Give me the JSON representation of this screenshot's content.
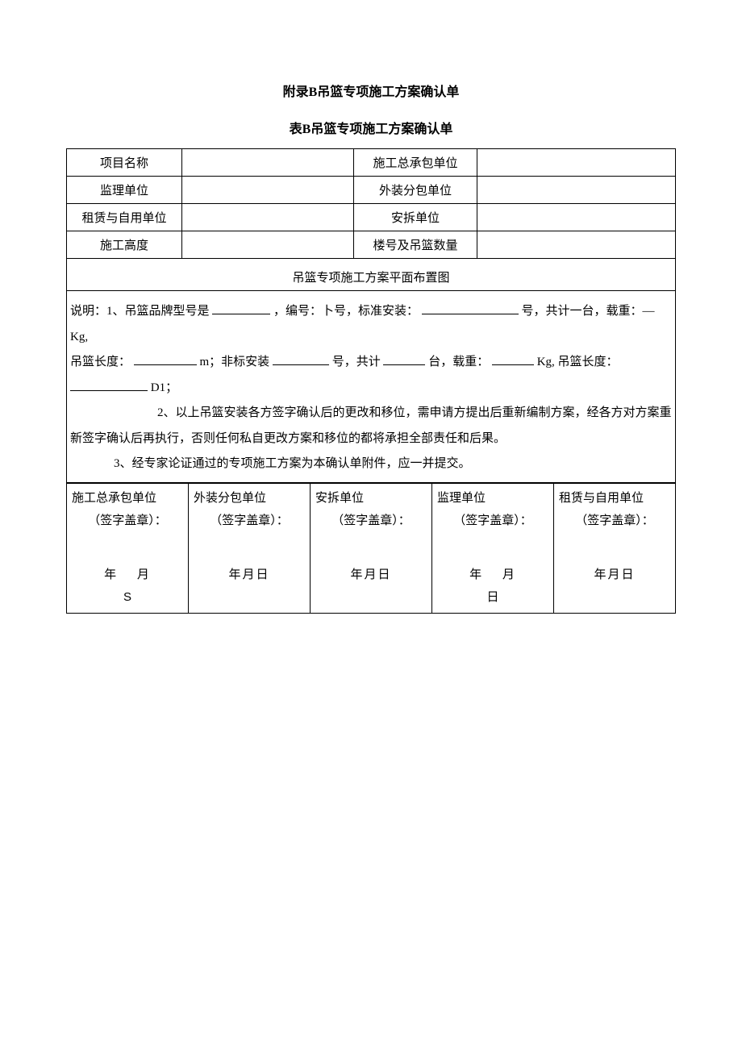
{
  "title": "附录B吊篮专项施工方案确认单",
  "subtitle": "表B吊篮专项施工方案确认单",
  "rows": {
    "r1a": "项目名称",
    "r1b": "施工总承包单位",
    "r2a": "监理单位",
    "r2b": "外装分包单位",
    "r3a": "租赁与自用单位",
    "r3b": "安拆单位",
    "r4a": "施工高度",
    "r4b": "楼号及吊篮数量"
  },
  "layout_title": "吊篮专项施工方案平面布置图",
  "explain": {
    "line1_a": "说明：1、吊篮品牌型号是",
    "line1_b": "，编号：卜号，标准安装：",
    "line1_c": "号，共计一台，载重：—Kg,",
    "line2_a": "吊篮长度：",
    "line2_b": "m；非标安装",
    "line2_c": "号，共计",
    "line2_d": "台，载重：",
    "line2_e": "Kg, 吊篮长度：",
    "line2_f": "D1；",
    "line3": "2、以上吊篮安装各方签字确认后的更改和移位，需申请方提出后重新编制方案，经各方对方案重新签字确认后再执行，否则任何私自更改方案和移位的都将承担全部责任和后果。",
    "line4": "3、经专家论证通过的专项施工方案为本确认单附件，应一并提交。"
  },
  "sign": {
    "stamp": "（签字盖章）：",
    "c1": "施工总承包单位",
    "c2": "外装分包单位",
    "c3": "安拆单位",
    "c4": "监理单位",
    "c5": "租赁与自用单位",
    "date_wide": "年  月",
    "date_compact": "年月日",
    "extra_s": "S",
    "extra_ri": "日"
  }
}
